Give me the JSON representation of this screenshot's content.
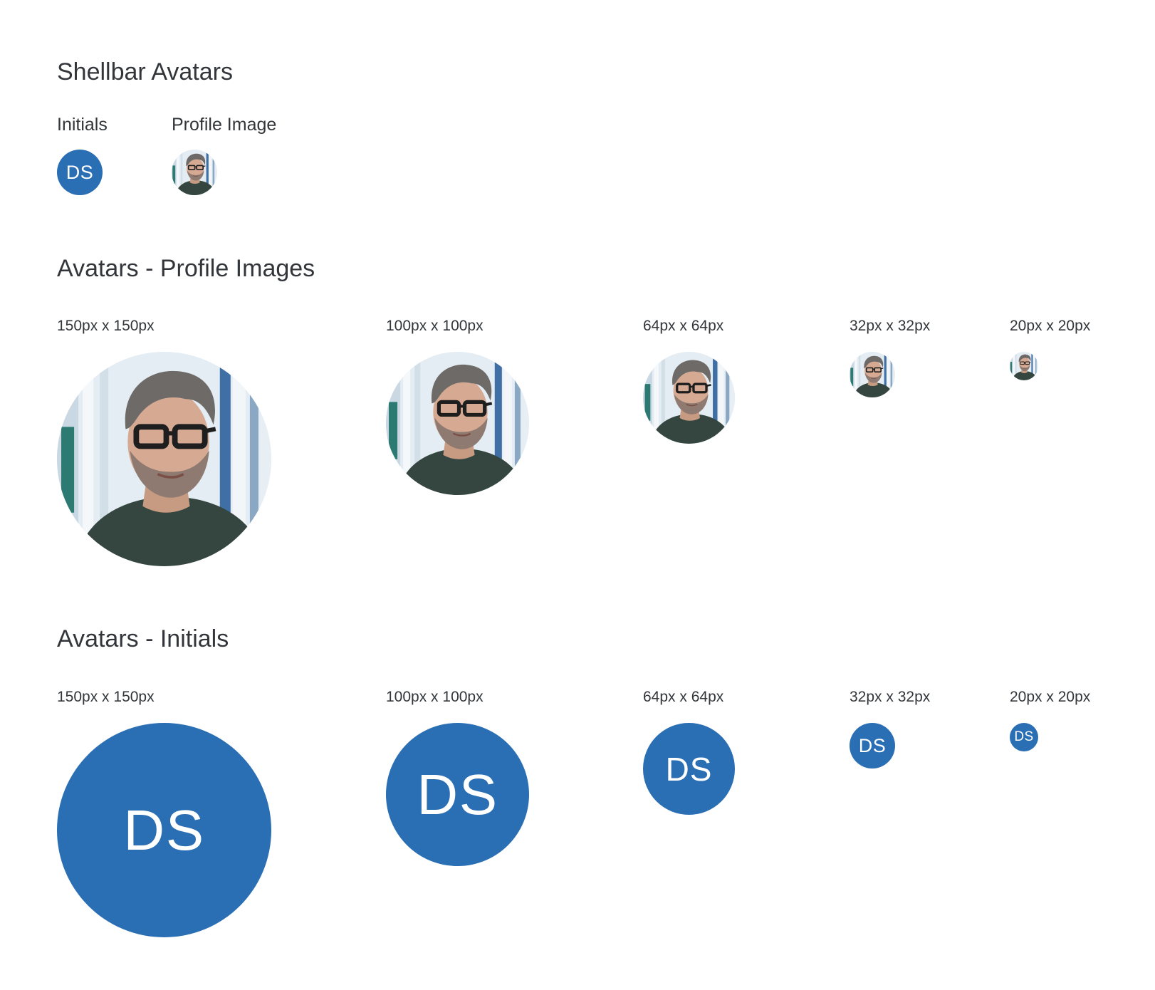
{
  "shellbar": {
    "title": "Shellbar Avatars",
    "initials_label": "Initials",
    "profile_label": "Profile Image",
    "initials": "DS",
    "profile_image": "person-photo"
  },
  "profile_images": {
    "title": "Avatars - Profile Images",
    "sizes": [
      {
        "label": "150px x 150px",
        "image": "person-photo"
      },
      {
        "label": "100px x 100px",
        "image": "person-photo"
      },
      {
        "label": "64px x 64px",
        "image": "person-photo"
      },
      {
        "label": "32px x 32px",
        "image": "person-photo"
      },
      {
        "label": "20px x 20px",
        "image": "person-photo"
      }
    ]
  },
  "initials": {
    "title": "Avatars - Initials",
    "sizes": [
      {
        "label": "150px x 150px",
        "text": "DS"
      },
      {
        "label": "100px x 100px",
        "text": "DS"
      },
      {
        "label": "64px x 64px",
        "text": "DS"
      },
      {
        "label": "32px x 32px",
        "text": "DS"
      },
      {
        "label": "20px x 20px",
        "text": "DS"
      }
    ]
  },
  "colors": {
    "avatar_background": "#2a6eb4",
    "avatar_text": "#ffffff",
    "text": "#32363a"
  }
}
